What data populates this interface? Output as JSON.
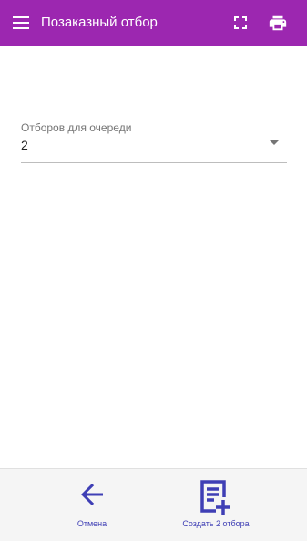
{
  "app_bar": {
    "title": "Позаказный отбор",
    "background": "#9c27b0",
    "icons": {
      "menu": "menu-icon",
      "fullscreen": "fullscreen-icon",
      "print": "print-icon"
    }
  },
  "form": {
    "queue_picks": {
      "label": "Отборов для очереди",
      "value": "2",
      "icon": "dropdown-arrow-icon"
    }
  },
  "bottom_bar": {
    "accent": "#3f3fb5",
    "cancel": {
      "label": "Отмена",
      "icon": "arrow-back-icon"
    },
    "create": {
      "label": "Создать 2 отбора",
      "icon": "note-add-icon"
    }
  }
}
